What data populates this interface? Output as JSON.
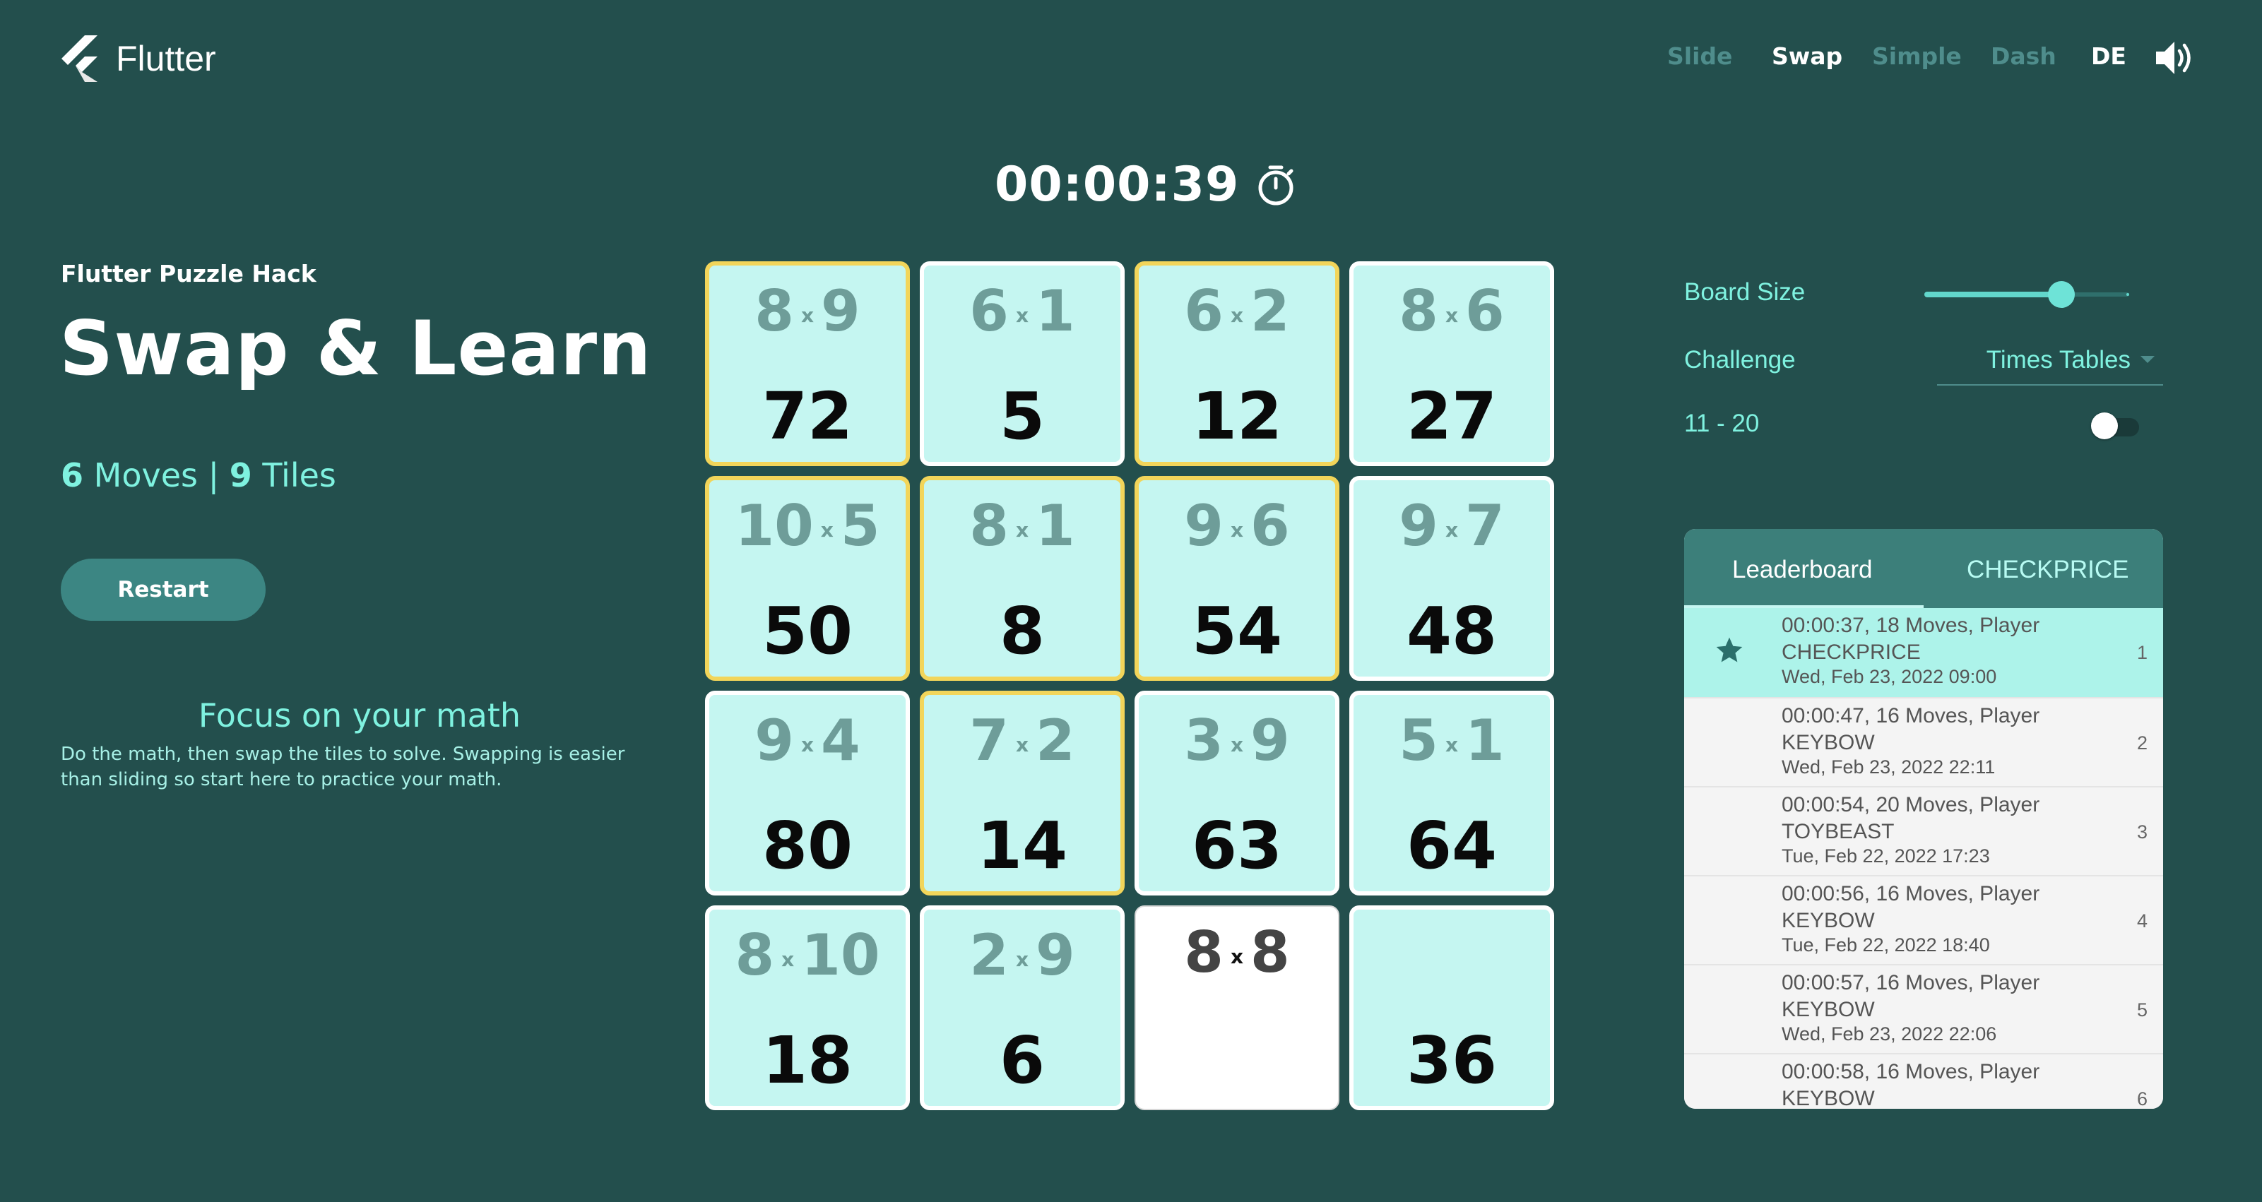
{
  "header": {
    "app_name": "Flutter",
    "nav": [
      {
        "label": "Slide",
        "active": false
      },
      {
        "label": "Swap",
        "active": true
      },
      {
        "label": "Simple",
        "active": false
      },
      {
        "label": "Dash",
        "active": false
      },
      {
        "label": "DE",
        "active": true
      }
    ],
    "sound_icon": "speaker-volume-icon"
  },
  "timer": {
    "value": "00:00:39",
    "icon": "stopwatch-icon"
  },
  "left": {
    "subtitle": "Flutter Puzzle Hack",
    "title": "Swap & Learn",
    "moves_count": "6",
    "moves_label": "Moves",
    "separator": "|",
    "tiles_count": "9",
    "tiles_label": "Tiles",
    "restart_label": "Restart",
    "focus_title": "Focus on your math",
    "focus_desc": "Do the math, then swap the tiles to solve. Swapping is easier than sliding so start here to practice your math."
  },
  "board": {
    "times_symbol": "x",
    "tiles": [
      {
        "a": "8",
        "b": "9",
        "answer": "72",
        "state": "gold"
      },
      {
        "a": "6",
        "b": "1",
        "answer": "5",
        "state": "normal"
      },
      {
        "a": "6",
        "b": "2",
        "answer": "12",
        "state": "gold"
      },
      {
        "a": "8",
        "b": "6",
        "answer": "27",
        "state": "normal"
      },
      {
        "a": "10",
        "b": "5",
        "answer": "50",
        "state": "gold"
      },
      {
        "a": "8",
        "b": "1",
        "answer": "8",
        "state": "gold"
      },
      {
        "a": "9",
        "b": "6",
        "answer": "54",
        "state": "gold"
      },
      {
        "a": "9",
        "b": "7",
        "answer": "48",
        "state": "normal"
      },
      {
        "a": "9",
        "b": "4",
        "answer": "80",
        "state": "normal"
      },
      {
        "a": "7",
        "b": "2",
        "answer": "14",
        "state": "gold"
      },
      {
        "a": "3",
        "b": "9",
        "answer": "63",
        "state": "normal"
      },
      {
        "a": "5",
        "b": "1",
        "answer": "64",
        "state": "normal"
      },
      {
        "a": "8",
        "b": "10",
        "answer": "18",
        "state": "normal"
      },
      {
        "a": "2",
        "b": "9",
        "answer": "6",
        "state": "normal"
      },
      {
        "a": "8",
        "b": "8",
        "answer": "",
        "state": "blank"
      },
      {
        "a": "",
        "b": "",
        "answer": "36",
        "state": "normal"
      }
    ]
  },
  "settings": {
    "board_size_label": "Board Size",
    "board_size_level": 0.67,
    "challenge_label": "Challenge",
    "challenge_value": "Times Tables",
    "range_label": "11 - 20",
    "range_toggle_on": false
  },
  "leaderboard": {
    "tabs": [
      "Leaderboard",
      "CHECKPRICE"
    ],
    "active_tab": 0,
    "rows": [
      {
        "line1": "00:00:37, 18 Moves, Player",
        "line2": "CHECKPRICE",
        "date": "Wed, Feb 23, 2022 09:00",
        "rank": "1",
        "highlight": true
      },
      {
        "line1": "00:00:47, 16 Moves, Player",
        "line2": "KEYBOW",
        "date": "Wed, Feb 23, 2022 22:11",
        "rank": "2",
        "highlight": false
      },
      {
        "line1": "00:00:54, 20 Moves, Player",
        "line2": "TOYBEAST",
        "date": "Tue, Feb 22, 2022 17:23",
        "rank": "3",
        "highlight": false
      },
      {
        "line1": "00:00:56, 16 Moves, Player",
        "line2": "KEYBOW",
        "date": "Tue, Feb 22, 2022 18:40",
        "rank": "4",
        "highlight": false
      },
      {
        "line1": "00:00:57, 16 Moves, Player",
        "line2": "KEYBOW",
        "date": "Wed, Feb 23, 2022 22:06",
        "rank": "5",
        "highlight": false
      },
      {
        "line1": "00:00:58, 16 Moves, Player",
        "line2": "KEYBOW",
        "date": "",
        "rank": "6",
        "highlight": false
      }
    ]
  },
  "colors": {
    "background": "#234f4d",
    "accent": "#7ff2e0",
    "tile": "#c5f6f1",
    "tile_gold_border": "#f2d55a",
    "leaderboard_header": "#3c7f7a"
  }
}
